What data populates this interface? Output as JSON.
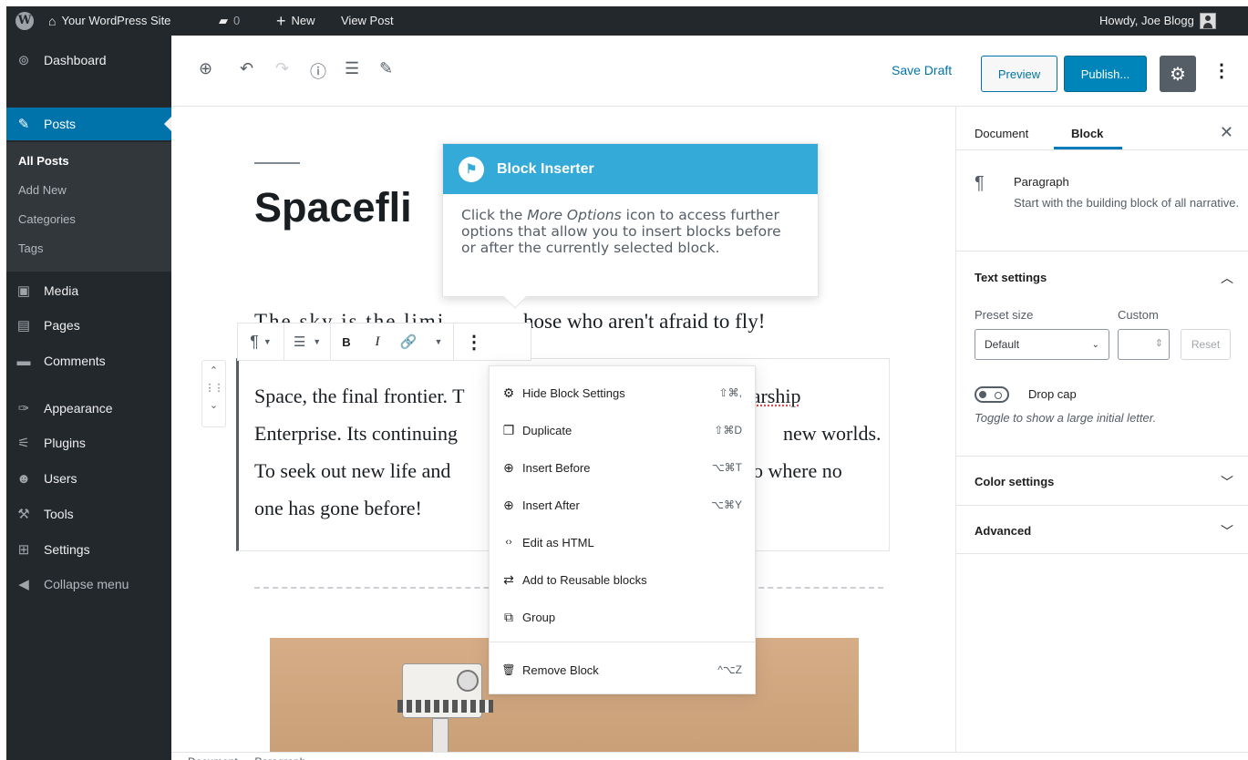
{
  "admin_bar": {
    "site_name": "Your WordPress Site",
    "comments_count": "0",
    "new_label": "New",
    "view_post_label": "View Post",
    "greeting": "Howdy, Joe Blogg"
  },
  "sidebar": {
    "items": [
      {
        "label": "Dashboard",
        "icon": "dashboard-icon",
        "glyph": "⊚"
      },
      {
        "label": "Posts",
        "icon": "pin-icon",
        "glyph": "✎"
      },
      {
        "label": "Media",
        "icon": "media-icon",
        "glyph": "▣"
      },
      {
        "label": "Pages",
        "icon": "pages-icon",
        "glyph": "▤"
      },
      {
        "label": "Comments",
        "icon": "comments-icon",
        "glyph": "▬"
      },
      {
        "label": "Appearance",
        "icon": "brush-icon",
        "glyph": "✑"
      },
      {
        "label": "Plugins",
        "icon": "plugin-icon",
        "glyph": "⚟"
      },
      {
        "label": "Users",
        "icon": "users-icon",
        "glyph": "☻"
      },
      {
        "label": "Tools",
        "icon": "wrench-icon",
        "glyph": "⚒"
      },
      {
        "label": "Settings",
        "icon": "settings-icon",
        "glyph": "⊞"
      },
      {
        "label": "Collapse menu",
        "icon": "collapse-icon",
        "glyph": "◀"
      }
    ],
    "submenu": [
      "All Posts",
      "Add New",
      "Categories",
      "Tags"
    ]
  },
  "header": {
    "save_draft": "Save Draft",
    "preview": "Preview",
    "publish": "Publish..."
  },
  "editor": {
    "title_visible": "Spacefli",
    "para1_left": "The sky is the limit...",
    "para1_right": "hose who aren't afraid to fly!",
    "block_lines": [
      {
        "left": "Space, the final frontier. T",
        "right": "starship"
      },
      {
        "left": "Enterprise. Its continuing",
        "right": "new worlds."
      },
      {
        "left": "To seek out new life and",
        "right": "o where no"
      },
      {
        "left": "one has gone before!",
        "right": ""
      }
    ]
  },
  "tooltip": {
    "title": "Block Inserter",
    "body_1": "Click the ",
    "body_em": "More Options",
    "body_2": " icon to access further options that allow you to insert blocks before or after the currently selected block."
  },
  "dropdown": {
    "items": [
      {
        "label": "Hide Block Settings",
        "shortcut": "⇧⌘,",
        "icon": "gear-icon",
        "glyph": "⚙"
      },
      {
        "label": "Duplicate",
        "shortcut": "⇧⌘D",
        "icon": "duplicate-icon",
        "glyph": "❐"
      },
      {
        "label": "Insert Before",
        "shortcut": "⌥⌘T",
        "icon": "insert-before-icon",
        "glyph": "⊕"
      },
      {
        "label": "Insert After",
        "shortcut": "⌥⌘Y",
        "icon": "insert-after-icon",
        "glyph": "⊕"
      },
      {
        "label": "Edit as HTML",
        "shortcut": "",
        "icon": "html-icon",
        "glyph": "‹›"
      },
      {
        "label": "Add to Reusable blocks",
        "shortcut": "",
        "icon": "reusable-icon",
        "glyph": "⇄"
      },
      {
        "label": "Group",
        "shortcut": "",
        "icon": "group-icon",
        "glyph": "⧉"
      }
    ],
    "remove": {
      "label": "Remove Block",
      "shortcut": "^⌥Z",
      "icon": "trash-icon",
      "glyph": "🗑"
    }
  },
  "panel": {
    "tab_document": "Document",
    "tab_block": "Block",
    "block_name": "Paragraph",
    "block_desc": "Start with the building block of all narrative.",
    "text_settings": "Text settings",
    "preset_label": "Preset size",
    "custom_label": "Custom",
    "preset_value": "Default",
    "reset_label": "Reset",
    "drop_cap": "Drop cap",
    "drop_cap_help": "Toggle to show a large initial letter.",
    "color_settings": "Color settings",
    "advanced": "Advanced"
  },
  "footer": {
    "breadcrumb": "Document  →  Paragraph"
  }
}
